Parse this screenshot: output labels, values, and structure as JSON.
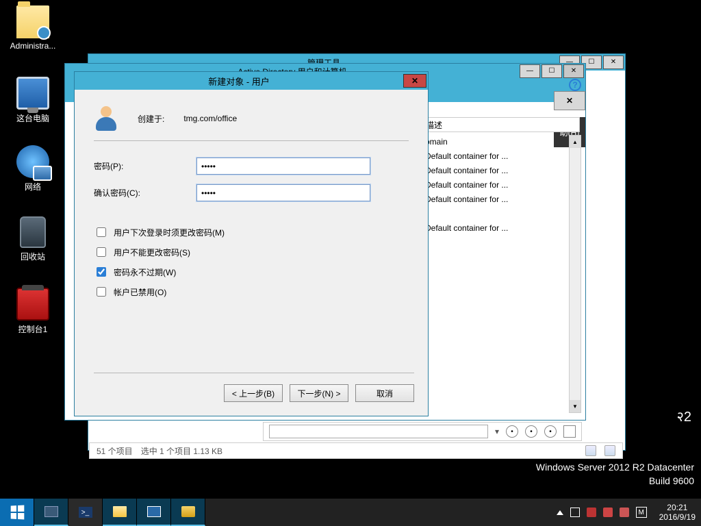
{
  "desktop": {
    "icons": [
      {
        "label": "Administra..."
      },
      {
        "label": "这台电脑"
      },
      {
        "label": "网络"
      },
      {
        "label": "回收站"
      },
      {
        "label": "控制台1"
      }
    ]
  },
  "bgwin": {
    "title": "管理工具"
  },
  "adwin": {
    "title": "Active Directory 用户和计算机",
    "col_desc": "描述",
    "help": "助(H)",
    "domain_frag": "omain",
    "r2_frag": "२2",
    "rows": [
      "Default container for ...",
      "Default container for ...",
      "Default container for ...",
      "Default container for ...",
      "",
      "Default container for ..."
    ]
  },
  "dialog": {
    "title": "新建对象 - 用户",
    "created_in_label": "创建于:",
    "created_in_path": "tmg.com/office",
    "password_label": "密码(P):",
    "confirm_label": "确认密码(C):",
    "password_value": "•••••",
    "confirm_value": "•••••",
    "chk_must_change": "用户下次登录时须更改密码(M)",
    "chk_cannot_change": "用户不能更改密码(S)",
    "chk_never_expires": "密码永不过期(W)",
    "chk_disabled": "帐户已禁用(O)",
    "btn_back": "< 上一步(B)",
    "btn_next": "下一步(N) >",
    "btn_cancel": "取消"
  },
  "statusbar": {
    "items_text": "51 个项目",
    "selected_text": "选中 1 个项目  1.13 KB"
  },
  "watermark": {
    "line1": "Windows Server 2012 R2 Datacenter",
    "line2": "Build 9600"
  },
  "taskbar": {
    "ime": "M",
    "time": "20:21",
    "date": "2016/9/19"
  }
}
